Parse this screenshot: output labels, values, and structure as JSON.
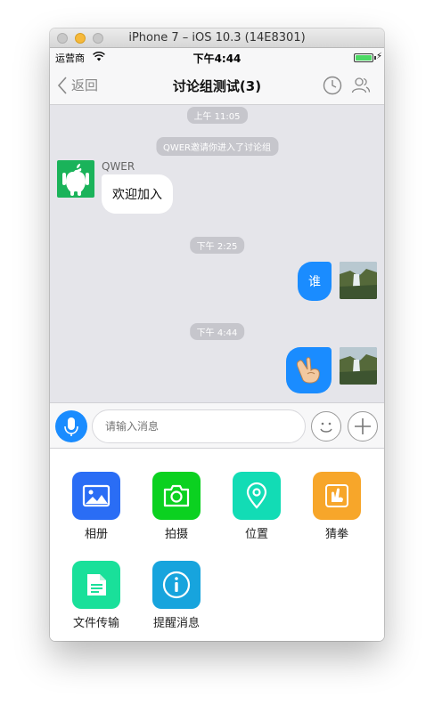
{
  "window": {
    "title": "iPhone 7 – iOS 10.3 (14E8301)"
  },
  "status_bar": {
    "carrier": "运营商",
    "time": "下午4:44",
    "battery_level": 1.0
  },
  "nav": {
    "back_label": "返回",
    "title": "讨论组测试(3)"
  },
  "chat": {
    "timestamps": [
      "上午 11:05",
      "下午 2:25",
      "下午 4:44"
    ],
    "system_message": "QWER邀请你进入了讨论组",
    "incoming": {
      "sender": "QWER",
      "text": "欢迎加入"
    },
    "outgoing_text": "谁",
    "outgoing_emoji": "peace-hand-emoji"
  },
  "input": {
    "placeholder": "请输入消息"
  },
  "panel": {
    "items": [
      {
        "label": "相册",
        "icon": "photo-album-icon",
        "color": "#2a6df5"
      },
      {
        "label": "拍摄",
        "icon": "camera-icon",
        "color": "#0bd120"
      },
      {
        "label": "位置",
        "icon": "location-icon",
        "color": "#12dcb5"
      },
      {
        "label": "猜拳",
        "icon": "rock-paper-scissors-icon",
        "color": "#f7a62a"
      },
      {
        "label": "文件传输",
        "icon": "file-transfer-icon",
        "color": "#19e09a"
      },
      {
        "label": "提醒消息",
        "icon": "info-reminder-icon",
        "color": "#17a4dd"
      }
    ]
  },
  "colors": {
    "accent": "#1a8cff",
    "chat_background": "#e5e5ea"
  }
}
